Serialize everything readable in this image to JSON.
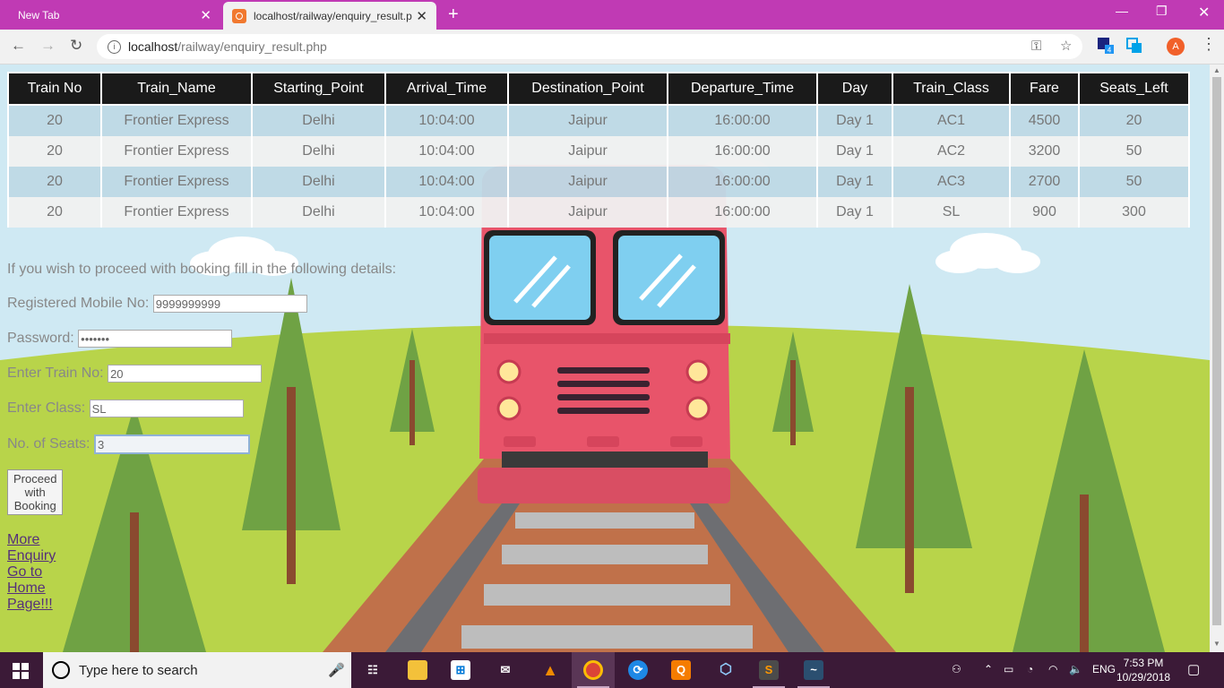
{
  "browser": {
    "tabs": [
      {
        "title": "New Tab"
      },
      {
        "title": "localhost/railway/enquiry_result.p"
      }
    ],
    "address": {
      "host": "localhost",
      "path": "/railway/enquiry_result.php"
    }
  },
  "results_table": {
    "headers": [
      "Train No",
      "Train_Name",
      "Starting_Point",
      "Arrival_Time",
      "Destination_Point",
      "Departure_Time",
      "Day",
      "Train_Class",
      "Fare",
      "Seats_Left"
    ],
    "rows": [
      [
        "20",
        "Frontier Express",
        "Delhi",
        "10:04:00",
        "Jaipur",
        "16:00:00",
        "Day 1",
        "AC1",
        "4500",
        "20"
      ],
      [
        "20",
        "Frontier Express",
        "Delhi",
        "10:04:00",
        "Jaipur",
        "16:00:00",
        "Day 1",
        "AC2",
        "3200",
        "50"
      ],
      [
        "20",
        "Frontier Express",
        "Delhi",
        "10:04:00",
        "Jaipur",
        "16:00:00",
        "Day 1",
        "AC3",
        "2700",
        "50"
      ],
      [
        "20",
        "Frontier Express",
        "Delhi",
        "10:04:00",
        "Jaipur",
        "16:00:00",
        "Day 1",
        "SL",
        "900",
        "300"
      ]
    ]
  },
  "form": {
    "intro": "If you wish to proceed with booking fill in the following details:",
    "mobile_label": "Registered Mobile No:",
    "mobile_value": "9999999999",
    "password_label": "Password:",
    "password_value": "•••••••",
    "train_label": "Enter Train No:",
    "train_value": "20",
    "class_label": "Enter Class:",
    "class_value": "SL",
    "seats_label": "No. of Seats:",
    "seats_value": "3",
    "submit_label": "Proceed with Booking"
  },
  "links": {
    "more_enquiry": "More Enquiry",
    "home": "Go to Home Page!!!"
  },
  "taskbar": {
    "search_placeholder": "Type here to search",
    "language": "ENG",
    "time": "7:53 PM",
    "date": "10/29/2018",
    "ext_badge": "4"
  },
  "profile_initial": "A",
  "colors": {
    "tabstrip": "#c03ab4",
    "taskbar": "#3b1a37",
    "table_header": "#1a1a1a",
    "row_odd": "#bed9e5",
    "row_even": "#f0f0f0",
    "train_body": "#e8546a",
    "grass": "#b8d44a",
    "sky": "#cfe9f3"
  }
}
